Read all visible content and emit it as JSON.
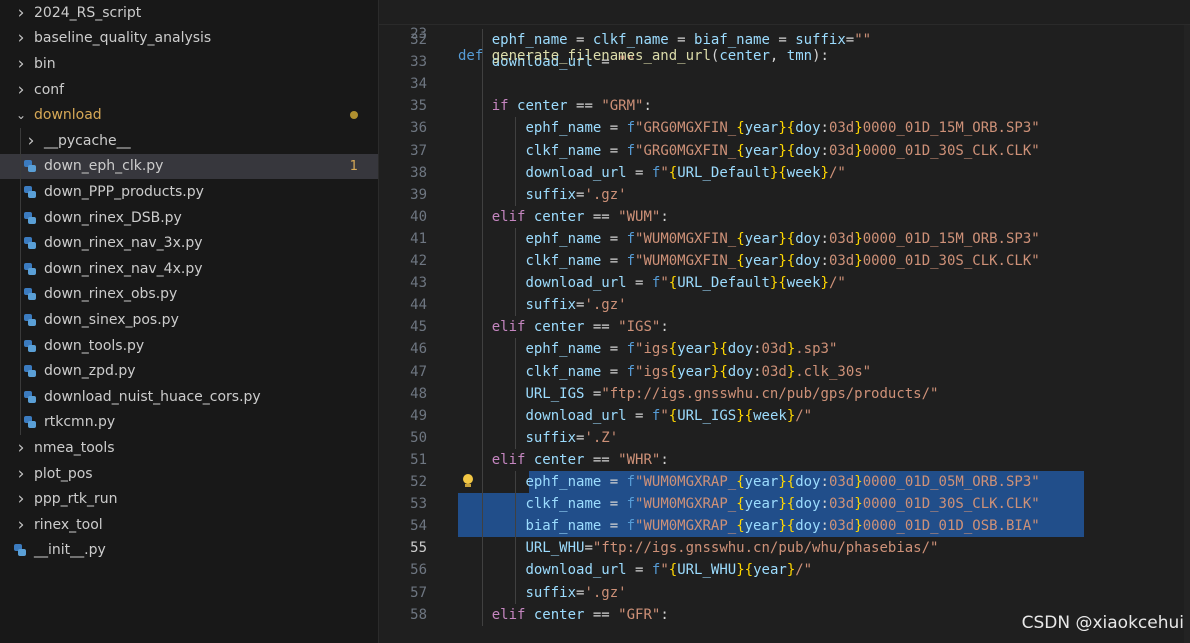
{
  "explorer": {
    "items": [
      {
        "label": "2024_RS_script",
        "kind": "folder",
        "state": "collapsed",
        "indent": 0
      },
      {
        "label": "baseline_quality_analysis",
        "kind": "folder",
        "state": "collapsed",
        "indent": 0
      },
      {
        "label": "bin",
        "kind": "folder",
        "state": "collapsed",
        "indent": 0
      },
      {
        "label": "conf",
        "kind": "folder",
        "state": "collapsed",
        "indent": 0
      },
      {
        "label": "download",
        "kind": "folder",
        "state": "expanded",
        "indent": 0,
        "badge": "dot"
      },
      {
        "label": "__pycache__",
        "kind": "folder",
        "state": "collapsed",
        "indent": 1
      },
      {
        "label": "down_eph_clk.py",
        "kind": "file",
        "indent": 1,
        "selected": true,
        "badge": "1"
      },
      {
        "label": "down_PPP_products.py",
        "kind": "file",
        "indent": 1
      },
      {
        "label": "down_rinex_DSB.py",
        "kind": "file",
        "indent": 1
      },
      {
        "label": "down_rinex_nav_3x.py",
        "kind": "file",
        "indent": 1
      },
      {
        "label": "down_rinex_nav_4x.py",
        "kind": "file",
        "indent": 1
      },
      {
        "label": "down_rinex_obs.py",
        "kind": "file",
        "indent": 1
      },
      {
        "label": "down_sinex_pos.py",
        "kind": "file",
        "indent": 1
      },
      {
        "label": "down_tools.py",
        "kind": "file",
        "indent": 1
      },
      {
        "label": "down_zpd.py",
        "kind": "file",
        "indent": 1
      },
      {
        "label": "download_nuist_huace_cors.py",
        "kind": "file",
        "indent": 1
      },
      {
        "label": "rtkcmn.py",
        "kind": "file",
        "indent": 1
      },
      {
        "label": "nmea_tools",
        "kind": "folder",
        "state": "collapsed",
        "indent": 0
      },
      {
        "label": "plot_pos",
        "kind": "folder",
        "state": "collapsed",
        "indent": 0
      },
      {
        "label": "ppp_rtk_run",
        "kind": "folder",
        "state": "collapsed",
        "indent": 0
      },
      {
        "label": "rinex_tool",
        "kind": "folder",
        "state": "collapsed",
        "indent": 0
      },
      {
        "label": "__init__.py",
        "kind": "file",
        "indent": 0
      }
    ]
  },
  "editor": {
    "sticky": {
      "line": "23",
      "text": "def generate_filenames_and_url(center, tmn):"
    },
    "lines": [
      {
        "n": "32",
        "text": "    ephf_name = clkf_name = biaf_name = suffix=\"\""
      },
      {
        "n": "33",
        "text": "    download_url = \"\""
      },
      {
        "n": "34",
        "text": ""
      },
      {
        "n": "35",
        "text": "    if center == \"GRM\":"
      },
      {
        "n": "36",
        "text": "        ephf_name = f\"GRG0MGXFIN_{year}{doy:03d}0000_01D_15M_ORB.SP3\""
      },
      {
        "n": "37",
        "text": "        clkf_name = f\"GRG0MGXFIN_{year}{doy:03d}0000_01D_30S_CLK.CLK\""
      },
      {
        "n": "38",
        "text": "        download_url = f\"{URL_Default}{week}/\""
      },
      {
        "n": "39",
        "text": "        suffix='.gz'"
      },
      {
        "n": "40",
        "text": "    elif center == \"WUM\":"
      },
      {
        "n": "41",
        "text": "        ephf_name = f\"WUM0MGXFIN_{year}{doy:03d}0000_01D_15M_ORB.SP3\""
      },
      {
        "n": "42",
        "text": "        clkf_name = f\"WUM0MGXFIN_{year}{doy:03d}0000_01D_30S_CLK.CLK\""
      },
      {
        "n": "43",
        "text": "        download_url = f\"{URL_Default}{week}/\""
      },
      {
        "n": "44",
        "text": "        suffix='.gz'"
      },
      {
        "n": "45",
        "text": "    elif center == \"IGS\":"
      },
      {
        "n": "46",
        "text": "        ephf_name = f\"igs{year}{doy:03d}.sp3\""
      },
      {
        "n": "47",
        "text": "        clkf_name = f\"igs{year}{doy:03d}.clk_30s\""
      },
      {
        "n": "48",
        "text": "        URL_IGS =\"ftp://igs.gnsswhu.cn/pub/gps/products/\""
      },
      {
        "n": "49",
        "text": "        download_url = f\"{URL_IGS}{week}/\""
      },
      {
        "n": "50",
        "text": "        suffix='.Z'"
      },
      {
        "n": "51",
        "text": "    elif center == \"WHR\":"
      },
      {
        "n": "52",
        "text": "        ephf_name = f\"WUM0MGXRAP_{year}{doy:03d}0000_01D_05M_ORB.SP3\"",
        "selected": true
      },
      {
        "n": "53",
        "text": "        clkf_name = f\"WUM0MGXRAP_{year}{doy:03d}0000_01D_30S_CLK.CLK\"",
        "selected": true
      },
      {
        "n": "54",
        "text": "        biaf_name = f\"WUM0MGXRAP_{year}{doy:03d}0000_01D_01D_OSB.BIA\"",
        "selected": true
      },
      {
        "n": "55",
        "text": "        URL_WHU=\"ftp://igs.gnsswhu.cn/pub/whu/phasebias/\"",
        "active": true
      },
      {
        "n": "56",
        "text": "        download_url = f\"{URL_WHU}{year}/\""
      },
      {
        "n": "57",
        "text": "        suffix='.gz'"
      },
      {
        "n": "58",
        "text": "    elif center == \"GFR\":"
      }
    ]
  },
  "watermark": "CSDN @xiaokcehui",
  "colors": {
    "keyword": "#569cd6",
    "control": "#c586c0",
    "function": "#dcdcaa",
    "variable": "#9cdcfe",
    "string": "#ce9178",
    "brace": "#ffd700",
    "selection": "#214e8a",
    "folder_modified": "#d7a957"
  }
}
